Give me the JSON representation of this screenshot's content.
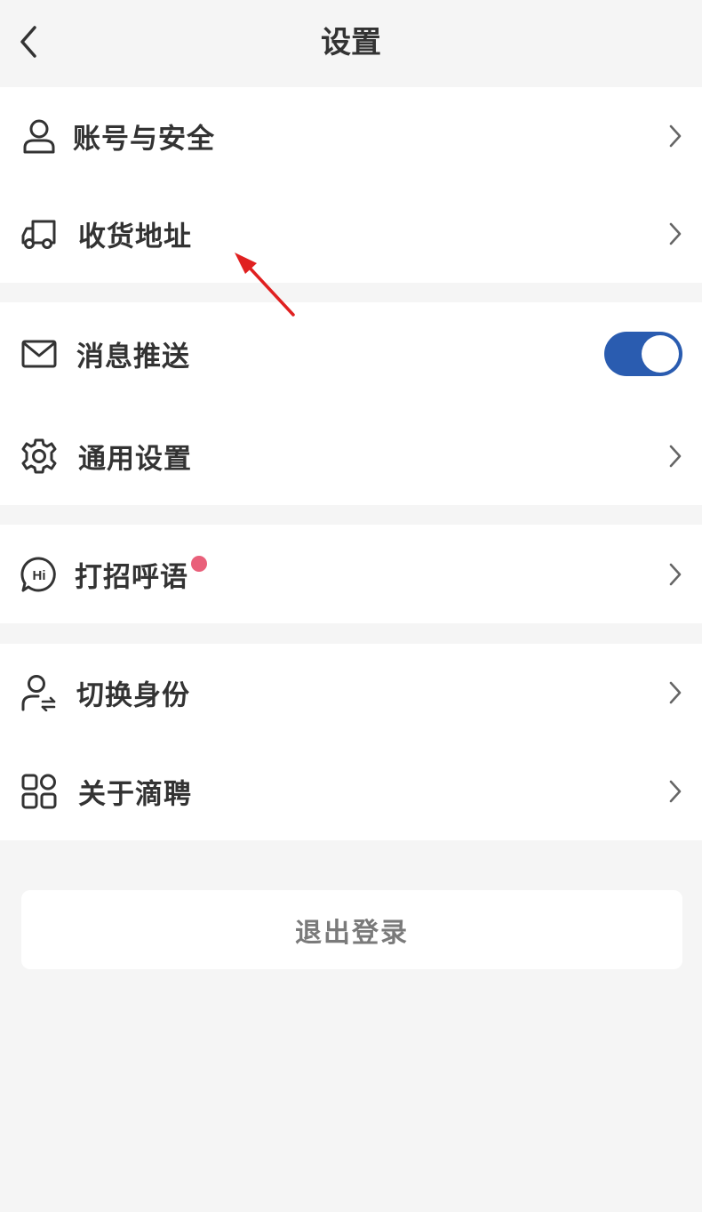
{
  "header": {
    "title": "设置",
    "back_icon": "chevron-left-icon"
  },
  "groups": [
    {
      "items": [
        {
          "label": "账号与安全",
          "icon": "user-icon"
        },
        {
          "label": "收货地址",
          "icon": "truck-icon"
        }
      ]
    },
    {
      "items": [
        {
          "label": "消息推送",
          "icon": "mail-icon",
          "toggle": true
        },
        {
          "label": "通用设置",
          "icon": "gear-icon"
        }
      ]
    },
    {
      "items": [
        {
          "label": "打招呼语",
          "icon": "hi-chat-icon",
          "badge": "red-dot"
        }
      ]
    },
    {
      "items": [
        {
          "label": "切换身份",
          "icon": "switch-user-icon"
        },
        {
          "label": "关于滴聘",
          "icon": "grid-apps-icon"
        }
      ]
    }
  ],
  "logout": {
    "label": "退出登录"
  },
  "colors": {
    "toggle_on": "#2a5cb0",
    "badge_dot": "#e9607a",
    "annotation_arrow": "#e02020",
    "background": "#f5f5f5"
  }
}
